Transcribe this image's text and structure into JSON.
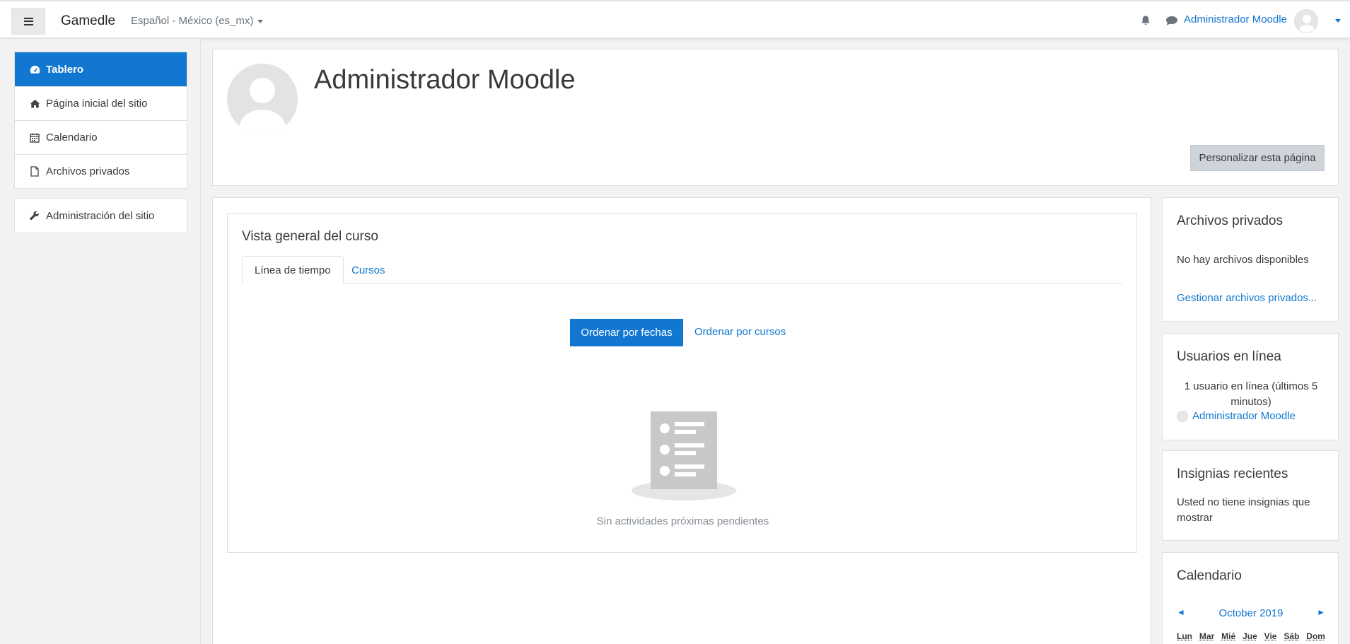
{
  "navbar": {
    "brand": "Gamedle",
    "language": "Español - México (es_mx)",
    "user_name": "Administrador Moodle"
  },
  "drawer": {
    "items": [
      {
        "label": "Tablero",
        "icon": "dashboard-icon"
      },
      {
        "label": "Página inicial del sitio",
        "icon": "home-icon"
      },
      {
        "label": "Calendario",
        "icon": "calendar-icon"
      },
      {
        "label": "Archivos privados",
        "icon": "file-icon"
      }
    ],
    "admin": {
      "label": "Administración del sitio",
      "icon": "wrench-icon"
    }
  },
  "header": {
    "title": "Administrador Moodle",
    "customize_label": "Personalizar esta página"
  },
  "course_overview": {
    "title": "Vista general del curso",
    "tabs": [
      {
        "label": "Línea de tiempo"
      },
      {
        "label": "Cursos"
      }
    ],
    "sort_dates_label": "Ordenar por fechas",
    "sort_courses_label": "Ordenar por cursos",
    "empty_text": "Sin actividades próximas pendientes"
  },
  "blocks": {
    "private_files": {
      "title": "Archivos privados",
      "text": "No hay archivos disponibles",
      "link": "Gestionar archivos privados..."
    },
    "online_users": {
      "title": "Usuarios en línea",
      "text": "1 usuario en línea (últimos 5 minutos)",
      "user": "Administrador Moodle"
    },
    "badges": {
      "title": "Insignias recientes",
      "text": "Usted no tiene insignias que mostrar"
    },
    "calendar": {
      "title": "Calendario",
      "month": "October 2019",
      "prev": "◄",
      "next": "►",
      "weekdays": [
        "Lun",
        "Mar",
        "Mié",
        "Jue",
        "Vie",
        "Sáb",
        "Dom"
      ]
    }
  },
  "colors": {
    "accent": "#1177d1",
    "page_bg": "#f2f2f2",
    "button_secondary": "#ced4da"
  }
}
